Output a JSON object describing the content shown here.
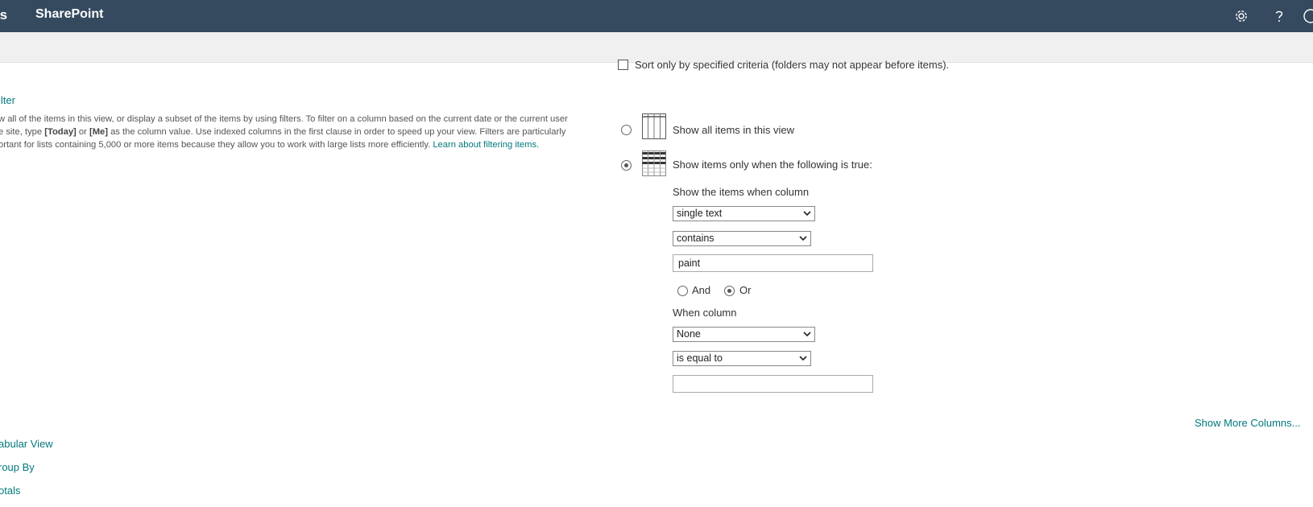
{
  "header": {
    "app_fragment": "ts",
    "app_name": "SharePoint",
    "icons": [
      "gear-icon",
      "help-icon",
      "account-icon"
    ],
    "colors": {
      "bar": "#354a5f",
      "link": "#03787c"
    }
  },
  "filter_section": {
    "title": "ilter",
    "desc_line1": "w all of the items in this view, or display a subset of the items by using filters. To filter on a column based on the current date or the current user",
    "desc_line2_a": "e site, type ",
    "desc_today": "[Today]",
    "desc_or": " or ",
    "desc_me": "[Me]",
    "desc_line2_b": " as the column value. Use indexed columns in the first clause in order to speed up your view. Filters are particularly",
    "desc_line3": "ortant for lists containing 5,000 or more items because they allow you to work with large lists more efficiently. ",
    "learn_link": "Learn about filtering items."
  },
  "sort": {
    "only_specified_label": "Sort only by specified criteria (folders may not appear before items)."
  },
  "filter_options": {
    "show_all_label": "Show all items in this view",
    "show_when_label": "Show items only when the following is true:",
    "selected": "show_when"
  },
  "clause1": {
    "heading": "Show the items when column",
    "column": "single text",
    "operator": "contains",
    "value": "paint"
  },
  "logic": {
    "and_label": "And",
    "or_label": "Or",
    "selected": "Or"
  },
  "clause2": {
    "heading": "When column",
    "column": "None",
    "operator": "is equal to",
    "value": ""
  },
  "show_more_columns": "Show More Columns...",
  "left_nav": {
    "tabular_view": "abular View",
    "group_by": "roup By",
    "totals": "otals"
  }
}
